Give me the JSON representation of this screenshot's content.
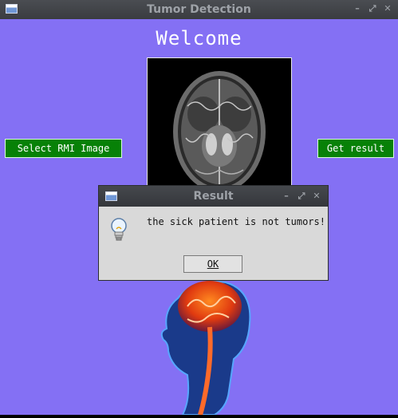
{
  "main_window": {
    "title": "Tumor Detection",
    "controls": {
      "minimize": "–",
      "maximize": "⤢",
      "close": "✕"
    }
  },
  "content": {
    "welcome": "Welcome",
    "select_button": "Select RMI Image",
    "result_button": "Get result"
  },
  "dialog": {
    "title": "Result",
    "message": "the sick patient is not tumors!",
    "ok_label": "OK",
    "icon": "lightbulb-icon",
    "controls": {
      "minimize": "–",
      "maximize": "⤢",
      "close": "✕"
    }
  },
  "colors": {
    "background": "#8470f4",
    "button_green": "#078107",
    "titlebar": "#3e4045"
  }
}
